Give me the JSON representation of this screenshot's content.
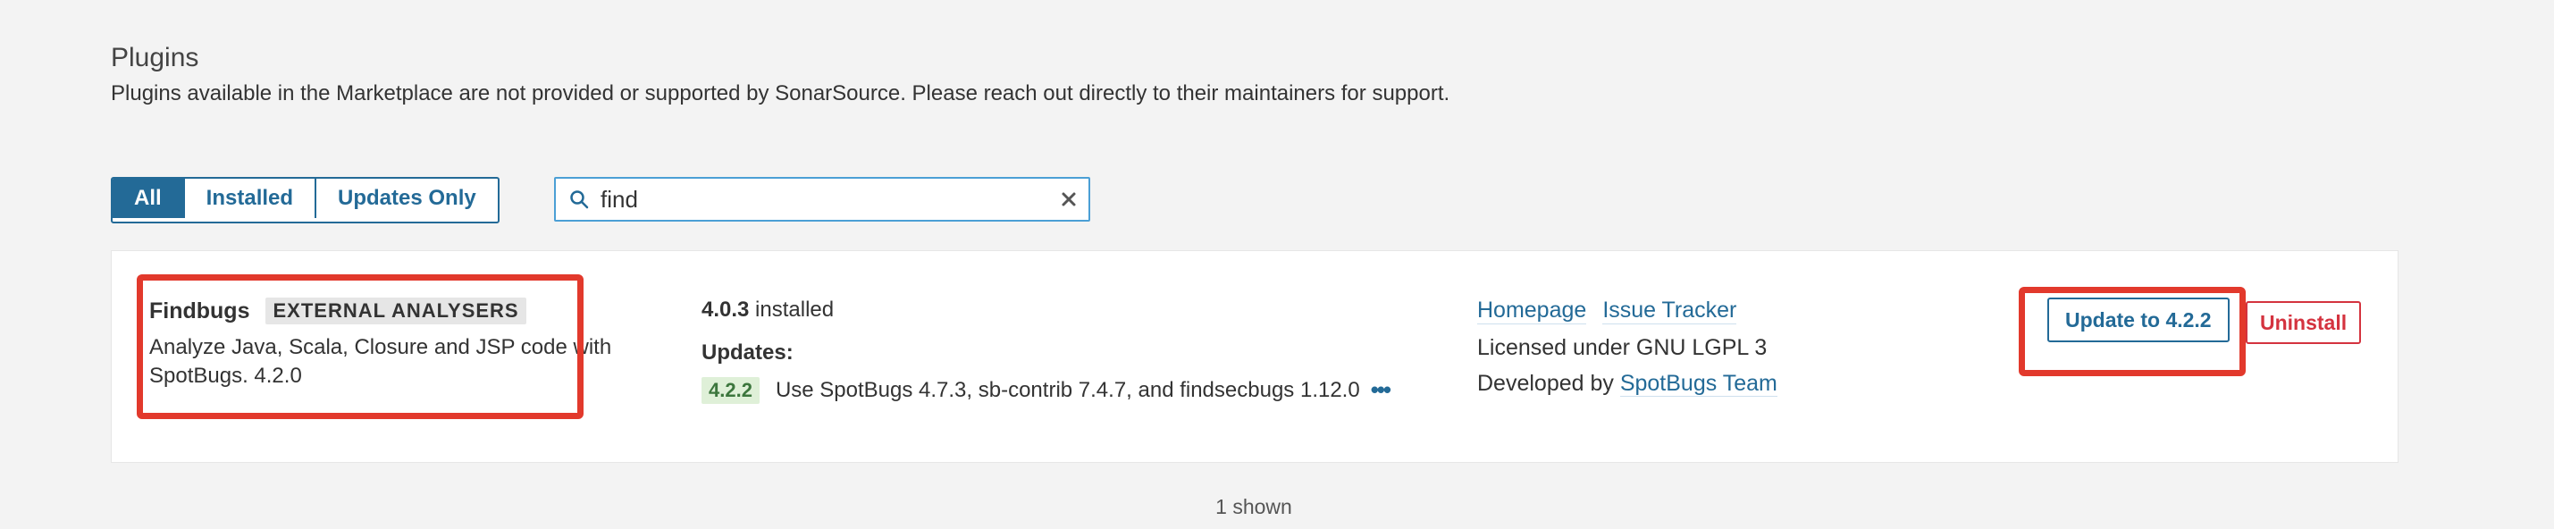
{
  "page": {
    "title": "Plugins",
    "notice": "Plugins available in the Marketplace are not provided or supported by SonarSource. Please reach out directly to their maintainers for support."
  },
  "filters": {
    "all": "All",
    "installed": "Installed",
    "updates_only": "Updates Only",
    "active": "All"
  },
  "search": {
    "value": "find",
    "icon": "search-icon",
    "clear_icon": "close-icon"
  },
  "plugin": {
    "name": "Findbugs",
    "category": "EXTERNAL ANALYSERS",
    "description": "Analyze Java, Scala, Closure and JSP code with SpotBugs. 4.2.0",
    "installed_version": "4.0.3",
    "installed_suffix": " installed",
    "updates_label": "Updates:",
    "update_version": "4.2.2",
    "update_text": "Use SpotBugs 4.7.3, sb-contrib 7.4.7, and findsecbugs 1.12.0",
    "ellipsis": "•••",
    "homepage_label": "Homepage",
    "issue_tracker_label": "Issue Tracker",
    "license": "Licensed under GNU LGPL 3",
    "developed_by": "Developed by ",
    "developer": "SpotBugs Team",
    "update_button": "Update to 4.2.2",
    "uninstall_button": "Uninstall"
  },
  "footer": {
    "shown": "1 shown"
  },
  "colors": {
    "accent": "#236a97",
    "danger": "#d4333f",
    "highlight": "#e2392c",
    "badge_green_bg": "#dff0d8"
  }
}
